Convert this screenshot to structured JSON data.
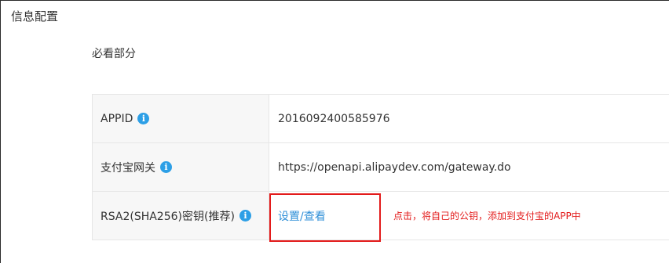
{
  "panel": {
    "title": "信息配置"
  },
  "section": {
    "title": "必看部分"
  },
  "rows": [
    {
      "label": "APPID",
      "value": "2016092400585976"
    },
    {
      "label": "支付宝网关",
      "value": "https://openapi.alipaydev.com/gateway.do"
    },
    {
      "label": "RSA2(SHA256)密钥(推荐)",
      "link": "设置/查看"
    }
  ],
  "info_icon_glyph": "i",
  "annotation": {
    "text": "点击，将自己的公钥，添加到支付宝的APP中",
    "color": "#e31b1b"
  },
  "colors": {
    "link": "#2f8fd8",
    "info_icon": "#2d9fe6",
    "label_bg": "#f7f7f7"
  }
}
